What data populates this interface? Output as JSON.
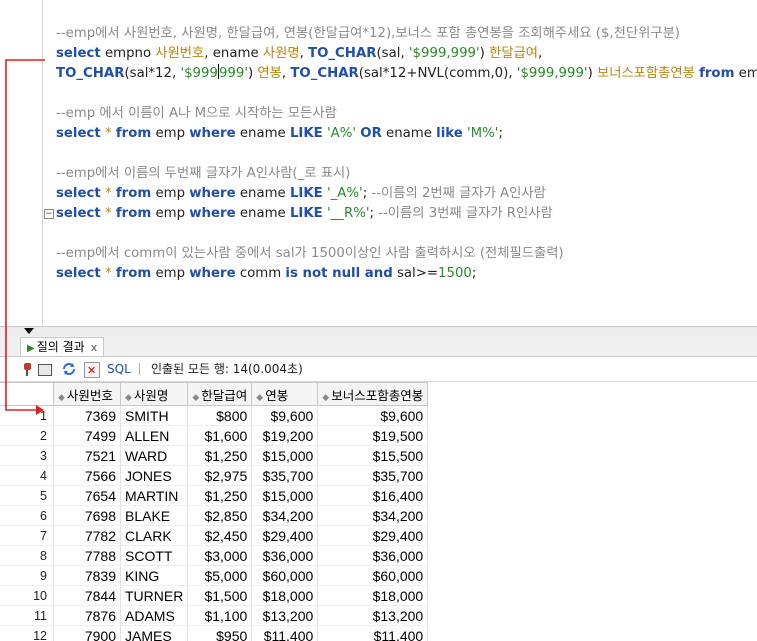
{
  "editor": {
    "lines": [
      {
        "tokens": [
          {
            "c": "cm",
            "t": "--emp에서 사원번호, 사원명, 한달급여, 연봉(한달급여*12),보너스 포함 총연봉을 조회해주세요 ($,천단위구분)"
          }
        ]
      },
      {
        "tokens": [
          {
            "c": "kw",
            "t": "select"
          },
          {
            "c": "pl",
            "t": " empno "
          },
          {
            "c": "al",
            "t": "사원번호"
          },
          {
            "c": "pl",
            "t": ", ename "
          },
          {
            "c": "al",
            "t": "사원명"
          },
          {
            "c": "pl",
            "t": ", "
          },
          {
            "c": "kw",
            "t": "TO_CHAR"
          },
          {
            "c": "pl",
            "t": "(sal, "
          },
          {
            "c": "st",
            "t": "'$999,999'"
          },
          {
            "c": "pl",
            "t": ") "
          },
          {
            "c": "al",
            "t": "한달급여"
          },
          {
            "c": "pl",
            "t": ","
          }
        ]
      },
      {
        "tokens": [
          {
            "c": "kw",
            "t": "TO_CHAR"
          },
          {
            "c": "pl",
            "t": "(sal*12, "
          },
          {
            "c": "st",
            "t": "'$999"
          },
          {
            "c": "caret",
            "t": ""
          },
          {
            "c": "st",
            "t": "999'"
          },
          {
            "c": "pl",
            "t": ") "
          },
          {
            "c": "al",
            "t": "연봉"
          },
          {
            "c": "pl",
            "t": ", "
          },
          {
            "c": "kw",
            "t": "TO_CHAR"
          },
          {
            "c": "pl",
            "t": "(sal*12+NVL(comm,0), "
          },
          {
            "c": "st",
            "t": "'$999,999'"
          },
          {
            "c": "pl",
            "t": ") "
          },
          {
            "c": "al",
            "t": "보너스포함총연봉"
          },
          {
            "c": "pl",
            "t": " "
          },
          {
            "c": "kw",
            "t": "from"
          },
          {
            "c": "pl",
            "t": " emp;"
          }
        ]
      },
      {
        "tokens": []
      },
      {
        "tokens": [
          {
            "c": "cm",
            "t": "--emp 에서 이름이 A나 M으로 시작하는 모든사람"
          }
        ]
      },
      {
        "tokens": [
          {
            "c": "kw",
            "t": "select"
          },
          {
            "c": "pl",
            "t": " "
          },
          {
            "c": "al",
            "t": "*"
          },
          {
            "c": "pl",
            "t": " "
          },
          {
            "c": "kw",
            "t": "from"
          },
          {
            "c": "pl",
            "t": " emp "
          },
          {
            "c": "kw",
            "t": "where"
          },
          {
            "c": "pl",
            "t": " ename "
          },
          {
            "c": "kw",
            "t": "LIKE"
          },
          {
            "c": "pl",
            "t": " "
          },
          {
            "c": "st",
            "t": "'A%'"
          },
          {
            "c": "pl",
            "t": " "
          },
          {
            "c": "kw",
            "t": "OR"
          },
          {
            "c": "pl",
            "t": " ename "
          },
          {
            "c": "kw",
            "t": "like"
          },
          {
            "c": "pl",
            "t": " "
          },
          {
            "c": "st",
            "t": "'M%'"
          },
          {
            "c": "pl",
            "t": ";"
          }
        ]
      },
      {
        "tokens": []
      },
      {
        "tokens": [
          {
            "c": "cm",
            "t": "--emp에서 이름의 두번째 글자가 A인사람(_로 표시)"
          }
        ]
      },
      {
        "tokens": [
          {
            "c": "kw",
            "t": "select"
          },
          {
            "c": "pl",
            "t": " "
          },
          {
            "c": "al",
            "t": "*"
          },
          {
            "c": "pl",
            "t": " "
          },
          {
            "c": "kw",
            "t": "from"
          },
          {
            "c": "pl",
            "t": " emp "
          },
          {
            "c": "kw",
            "t": "where"
          },
          {
            "c": "pl",
            "t": " ename "
          },
          {
            "c": "kw",
            "t": "LIKE"
          },
          {
            "c": "pl",
            "t": " "
          },
          {
            "c": "st",
            "t": "'_A%'"
          },
          {
            "c": "pl",
            "t": "; "
          },
          {
            "c": "cm",
            "t": "--이름의 2번째 글자가 A인사람"
          }
        ]
      },
      {
        "tokens": [
          {
            "c": "kw",
            "t": "select"
          },
          {
            "c": "pl",
            "t": " "
          },
          {
            "c": "al",
            "t": "*"
          },
          {
            "c": "pl",
            "t": " "
          },
          {
            "c": "kw",
            "t": "from"
          },
          {
            "c": "pl",
            "t": " emp "
          },
          {
            "c": "kw",
            "t": "where"
          },
          {
            "c": "pl",
            "t": " ename "
          },
          {
            "c": "kw",
            "t": "LIKE"
          },
          {
            "c": "pl",
            "t": " "
          },
          {
            "c": "st",
            "t": "'__R%'"
          },
          {
            "c": "pl",
            "t": "; "
          },
          {
            "c": "cm",
            "t": "--이름의 3번째 글자가 R인사람"
          }
        ]
      },
      {
        "tokens": []
      },
      {
        "tokens": [
          {
            "c": "cm",
            "t": "--emp에서 comm이 있는사람 중에서 sal가 1500이상인 사람 출력하시오 (전체필드출력)"
          }
        ]
      },
      {
        "tokens": [
          {
            "c": "kw",
            "t": "select"
          },
          {
            "c": "pl",
            "t": " "
          },
          {
            "c": "al",
            "t": "*"
          },
          {
            "c": "pl",
            "t": " "
          },
          {
            "c": "kw",
            "t": "from"
          },
          {
            "c": "pl",
            "t": " emp "
          },
          {
            "c": "kw",
            "t": "where"
          },
          {
            "c": "pl",
            "t": " comm "
          },
          {
            "c": "kw",
            "t": "is not null and"
          },
          {
            "c": "pl",
            "t": " sal>="
          },
          {
            "c": "st",
            "t": "1500"
          },
          {
            "c": "pl",
            "t": ";"
          }
        ]
      }
    ]
  },
  "results": {
    "tab_label": "질의 결과",
    "tab_close": "x",
    "sql_label": "SQL",
    "fetch_status": "인출된 모든 행: 14(0.004초)"
  },
  "table": {
    "columns": [
      "사원번호",
      "사원명",
      "한달급여",
      "연봉",
      "보너스포함총연봉"
    ],
    "rows": [
      [
        "1",
        "7369",
        "SMITH",
        "$800",
        "$9,600",
        "$9,600"
      ],
      [
        "2",
        "7499",
        "ALLEN",
        "$1,600",
        "$19,200",
        "$19,500"
      ],
      [
        "3",
        "7521",
        "WARD",
        "$1,250",
        "$15,000",
        "$15,500"
      ],
      [
        "4",
        "7566",
        "JONES",
        "$2,975",
        "$35,700",
        "$35,700"
      ],
      [
        "5",
        "7654",
        "MARTIN",
        "$1,250",
        "$15,000",
        "$16,400"
      ],
      [
        "6",
        "7698",
        "BLAKE",
        "$2,850",
        "$34,200",
        "$34,200"
      ],
      [
        "7",
        "7782",
        "CLARK",
        "$2,450",
        "$29,400",
        "$29,400"
      ],
      [
        "8",
        "7788",
        "SCOTT",
        "$3,000",
        "$36,000",
        "$36,000"
      ],
      [
        "9",
        "7839",
        "KING",
        "$5,000",
        "$60,000",
        "$60,000"
      ],
      [
        "10",
        "7844",
        "TURNER",
        "$1,500",
        "$18,000",
        "$18,000"
      ],
      [
        "11",
        "7876",
        "ADAMS",
        "$1,100",
        "$13,200",
        "$13,200"
      ],
      [
        "12",
        "7900",
        "JAMES",
        "$950",
        "$11,400",
        "$11,400"
      ]
    ]
  },
  "colors": {
    "keyword": "#1f4fa8",
    "alias": "#b8860b",
    "string": "#2a8a2a",
    "comment": "#8a8a8a",
    "annotation": "#e0201c"
  }
}
